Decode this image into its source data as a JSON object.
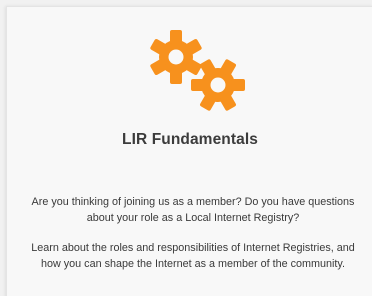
{
  "card": {
    "title": "LIR Fundamentals",
    "paragraphs": [
      "Are you thinking of joining us as a member? Do you have questions about your role as a Local Internet Registry?",
      "Learn about the roles and responsibilities of Internet Registries, and how you can shape the Internet as a member of the community."
    ],
    "icon": "gears-icon",
    "accent_color": "#f7911d"
  }
}
